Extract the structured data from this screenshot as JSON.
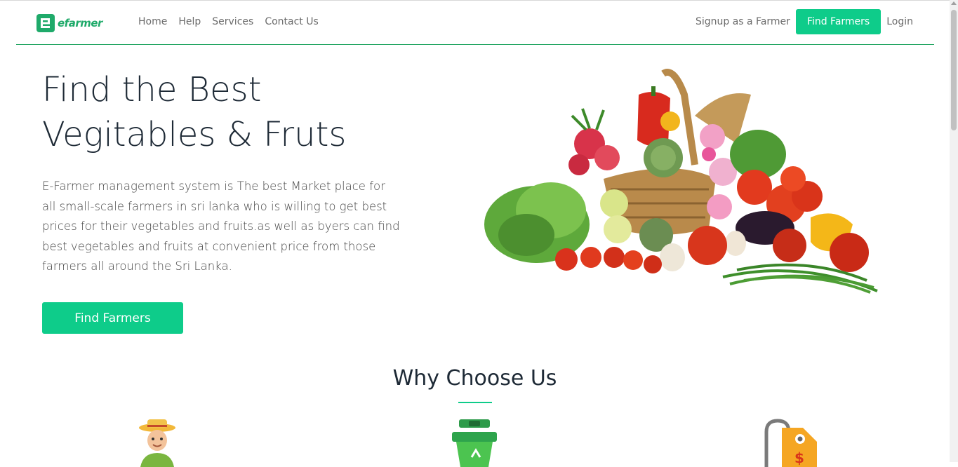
{
  "brand": {
    "name": "efarmer",
    "color": "#1faa6a",
    "accent": "#0ecc8a"
  },
  "nav": {
    "links": [
      "Home",
      "Help",
      "Services",
      "Contact Us"
    ],
    "signup": "Signup as a Farmer",
    "find_farmers": "Find Farmers",
    "login": "Login"
  },
  "hero": {
    "title_line1": "Find the Best",
    "title_line2": "Vegitables & Fruts",
    "description": "E-Farmer management system is The best Market place for all small-scale farmers in sri lanka who is willing to get best prices for their vegetables and fruits.as well as byers can find best vegetables and fruits at convenient price from those farmers all around the Sri Lanka.",
    "cta": "Find Farmers"
  },
  "why": {
    "title": "Why Choose Us",
    "features": [
      {
        "icon": "farmer-icon"
      },
      {
        "icon": "recycle-bin-icon"
      },
      {
        "icon": "price-tag-icon"
      }
    ]
  }
}
